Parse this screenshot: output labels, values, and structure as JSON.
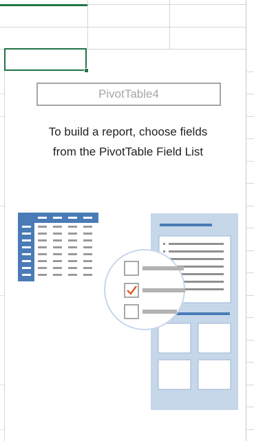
{
  "pivot": {
    "name": "PivotTable4",
    "instruction_line1": "To build a report, choose fields",
    "instruction_line2": "from the PivotTable Field List"
  },
  "colors": {
    "accent_green": "#217346",
    "table_blue": "#4a7bb7",
    "panel_blue": "#c7d7ea",
    "check_red": "#e05a2b",
    "placeholder_gray": "#a6a6a6"
  },
  "icons": {
    "illustration": "pivot-field-list-illustration"
  }
}
